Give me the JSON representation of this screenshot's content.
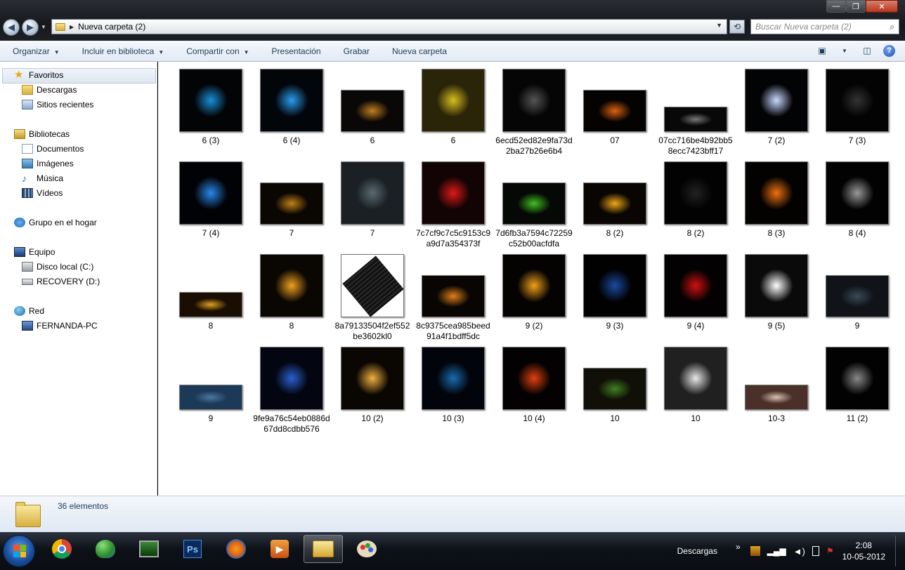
{
  "window": {
    "controls": {
      "minimize": "—",
      "maximize": "❐",
      "close": "✕"
    }
  },
  "nav": {
    "back": "◀",
    "forward": "▶",
    "address": "Nueva carpeta (2)",
    "search_placeholder": "Buscar Nueva carpeta (2)"
  },
  "toolbar": {
    "organize": "Organizar",
    "include": "Incluir en biblioteca",
    "share": "Compartir con",
    "slideshow": "Presentación",
    "burn": "Grabar",
    "new_folder": "Nueva carpeta"
  },
  "sidebar": {
    "favorites": "Favoritos",
    "downloads": "Descargas",
    "recent": "Sitios recientes",
    "libraries": "Bibliotecas",
    "documents": "Documentos",
    "images": "Imágenes",
    "music": "Música",
    "videos": "Vídeos",
    "homegroup": "Grupo en el hogar",
    "computer": "Equipo",
    "local_disk": "Disco local (C:)",
    "recovery": "RECOVERY (D:)",
    "network": "Red",
    "pc": "FERNANDA-PC"
  },
  "files": [
    {
      "name": "6 (3)",
      "bg": "#020406",
      "accent": "#1a8fd8"
    },
    {
      "name": "6 (4)",
      "bg": "#02050a",
      "accent": "#2a9cf0"
    },
    {
      "name": "6",
      "bg": "#0a0806",
      "accent": "#c08020",
      "wide": true
    },
    {
      "name": "6",
      "bg": "#2a2408",
      "accent": "#d8c020"
    },
    {
      "name": "6ecd52ed82e9fa73d2ba27b26e6b4",
      "bg": "#050505",
      "accent": "#555"
    },
    {
      "name": "07",
      "bg": "#050302",
      "accent": "#e06010",
      "wide": true
    },
    {
      "name": "07cc716be4b92bb58ecc7423bff17",
      "bg": "#080808",
      "accent": "#777",
      "short": true
    },
    {
      "name": "7 (2)",
      "bg": "#020305",
      "accent": "#c8d8ff"
    },
    {
      "name": "7 (3)",
      "bg": "#030303",
      "accent": "#333"
    },
    {
      "name": "7 (4)",
      "bg": "#010205",
      "accent": "#2a88ee"
    },
    {
      "name": "7",
      "bg": "#0a0602",
      "accent": "#c08018",
      "wide": true
    },
    {
      "name": "7",
      "bg": "#1a2024",
      "accent": "#5a6a70"
    },
    {
      "name": "7c7cf9c7c5c9153c9a9d7a354373f",
      "bg": "#120404",
      "accent": "#e01818"
    },
    {
      "name": "7d6fb3a7594c72259c52b00acfdfa",
      "bg": "#050805",
      "accent": "#40c020",
      "wide": true
    },
    {
      "name": "8 (2)",
      "bg": "#080502",
      "accent": "#f0a818",
      "wide": true
    },
    {
      "name": "8 (2)",
      "bg": "#020202",
      "accent": "#222"
    },
    {
      "name": "8 (3)",
      "bg": "#030201",
      "accent": "#f07010"
    },
    {
      "name": "8 (4)",
      "bg": "#020202",
      "accent": "#999"
    },
    {
      "name": "8",
      "bg": "#1a0e02",
      "accent": "#e0a020",
      "flat": true
    },
    {
      "name": "8",
      "bg": "#0a0602",
      "accent": "#f0a020"
    },
    {
      "name": "8a79133504f2ef552be3602kl0",
      "bg": "#ffffff",
      "accent": "#111",
      "diamond": true
    },
    {
      "name": "8c9375cea985beed91a4f1bdff5dc",
      "bg": "#080503",
      "accent": "#e08018",
      "wide": true
    },
    {
      "name": "9 (2)",
      "bg": "#050302",
      "accent": "#f0a018"
    },
    {
      "name": "9 (3)",
      "bg": "#010102",
      "accent": "#1a4aa0"
    },
    {
      "name": "9 (4)",
      "bg": "#030101",
      "accent": "#d01010"
    },
    {
      "name": "9 (5)",
      "bg": "#0a0a0a",
      "accent": "#ffffff"
    },
    {
      "name": "9",
      "bg": "#101418",
      "accent": "#3a4a58",
      "wide": true
    },
    {
      "name": "9",
      "bg": "#1c3a58",
      "accent": "#4a78a0",
      "flat": true
    },
    {
      "name": "9fe9a76c54eb0886d67dd8cdbb576",
      "bg": "#030510",
      "accent": "#2a60d0"
    },
    {
      "name": "10 (2)",
      "bg": "#0a0602",
      "accent": "#f0b040"
    },
    {
      "name": "10 (3)",
      "bg": "#01040a",
      "accent": "#1a6ab0"
    },
    {
      "name": "10 (4)",
      "bg": "#030101",
      "accent": "#e04010"
    },
    {
      "name": "10",
      "bg": "#101008",
      "accent": "#408020",
      "wide": true
    },
    {
      "name": "10",
      "bg": "#202020",
      "accent": "#e8e8e8"
    },
    {
      "name": "10-3",
      "bg": "#4a3028",
      "accent": "#d8c0b0",
      "flat": true
    },
    {
      "name": "11 (2)",
      "bg": "#020202",
      "accent": "#888"
    }
  ],
  "status": {
    "count": "36 elementos"
  },
  "taskbar": {
    "tray_label": "Descargas",
    "chevron": "»",
    "time": "2:08",
    "date": "10-05-2012"
  }
}
